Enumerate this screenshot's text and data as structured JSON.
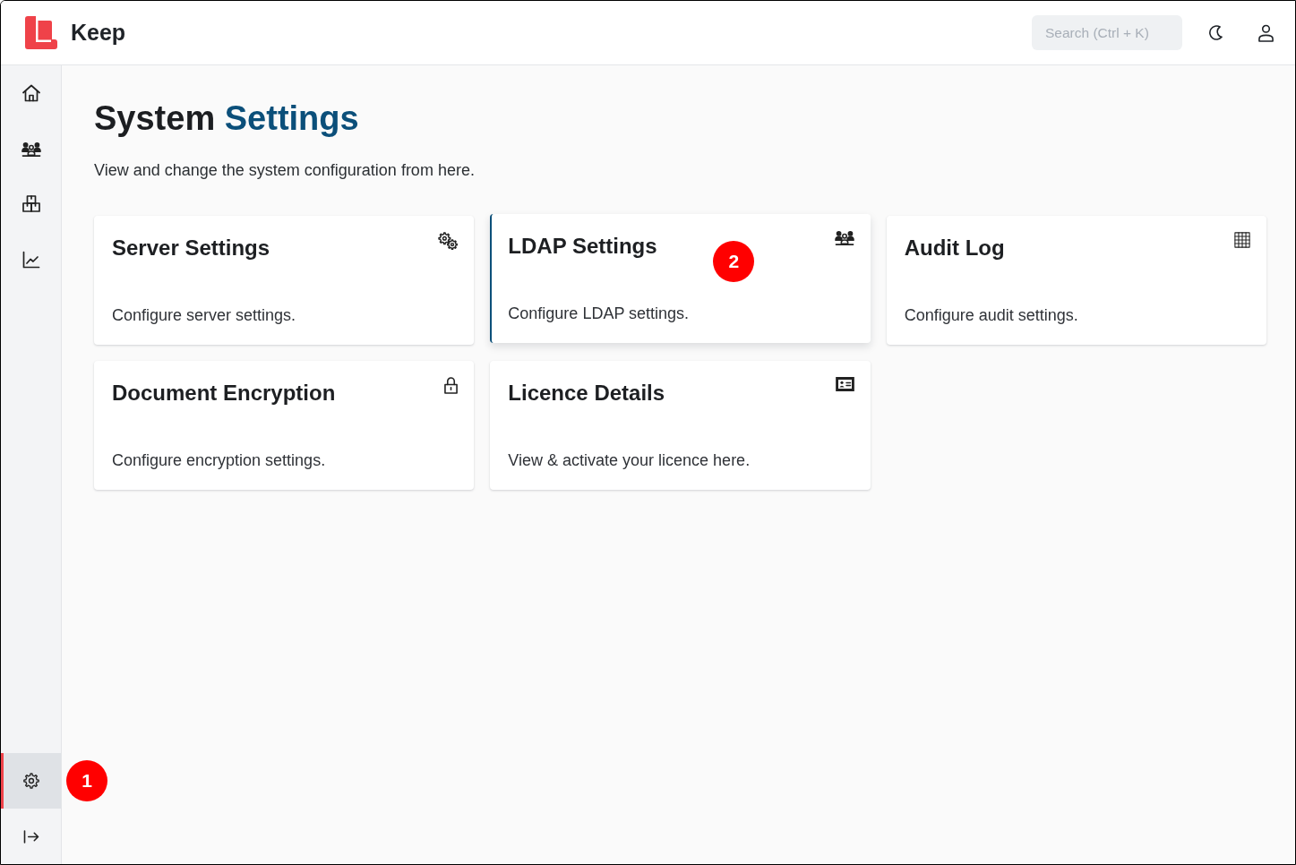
{
  "header": {
    "brand": "Keep",
    "search": {
      "placeholder": "Search (Ctrl + K)"
    }
  },
  "sidebar": {
    "nav_items": [
      {
        "selected": false
      },
      {
        "selected": false
      },
      {
        "selected": false
      },
      {
        "selected": false
      }
    ],
    "footer_items": [
      {
        "selected": true,
        "callout": "1"
      }
    ]
  },
  "page": {
    "title": {
      "lead": "System",
      "highlight": "Settings"
    },
    "subtitle": "View and change the system configuration from here.",
    "cards": [
      {
        "title": "Server Settings",
        "description": "Configure server settings.",
        "hovered": false
      },
      {
        "title": "LDAP Settings",
        "description": "Configure LDAP settings.",
        "hovered": true,
        "callout": "2"
      },
      {
        "title": "Audit Log",
        "description": "Configure audit settings.",
        "hovered": false
      },
      {
        "title": "Document Encryption",
        "description": "Configure encryption settings.",
        "hovered": false
      },
      {
        "title": "Licence Details",
        "description": "View & activate your licence here.",
        "hovered": false
      }
    ]
  }
}
